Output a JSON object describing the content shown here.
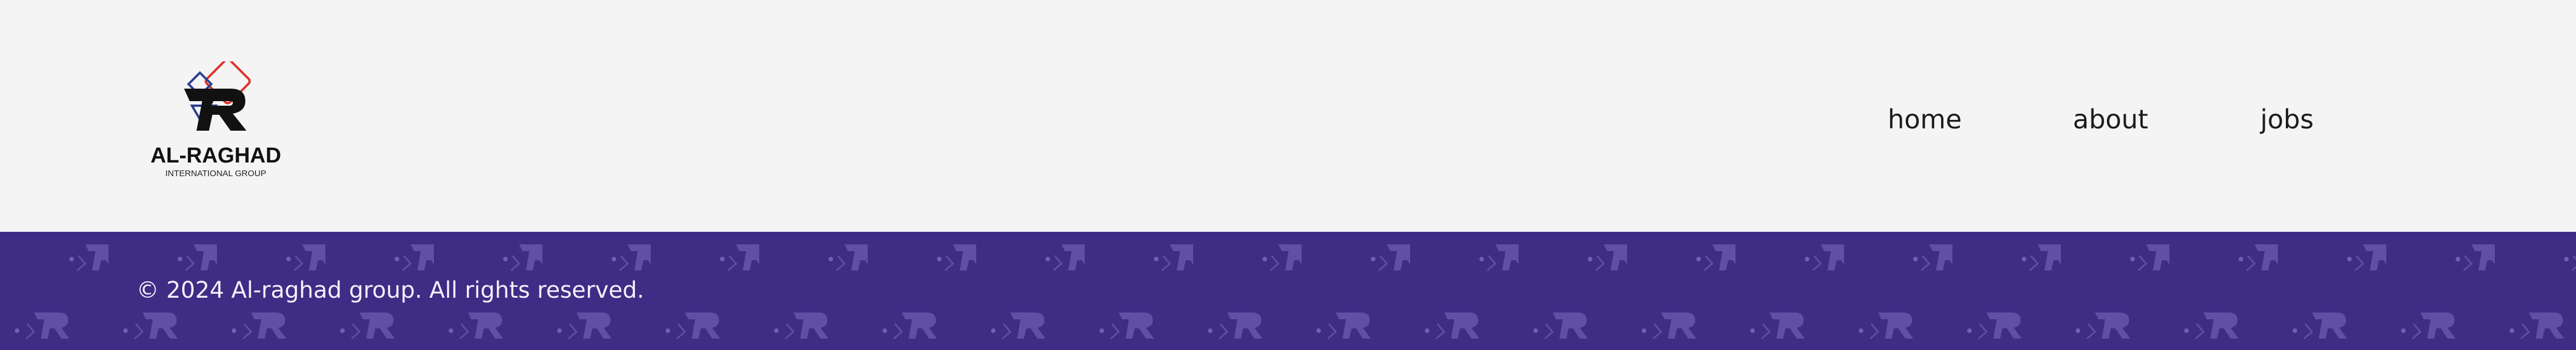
{
  "header": {
    "logo": {
      "name": "AL-RAGHAD",
      "subtitle": "INTERNATIONAL GROUP",
      "icon": "r-monogram-logo-icon"
    },
    "nav": [
      {
        "label": "home"
      },
      {
        "label": "about"
      },
      {
        "label": "jobs"
      }
    ]
  },
  "footer": {
    "copyright": "© 2024 Al-raghad group. All rights reserved.",
    "background_color": "#3f2c85",
    "pattern_icon": "r-monogram-pattern-icon"
  },
  "colors": {
    "header_bg": "#f4f4f4",
    "text_dark": "#1c1c1c",
    "logo_red": "#e0302a",
    "logo_blue": "#2a3f8f",
    "footer_bg": "#3f2c85"
  }
}
